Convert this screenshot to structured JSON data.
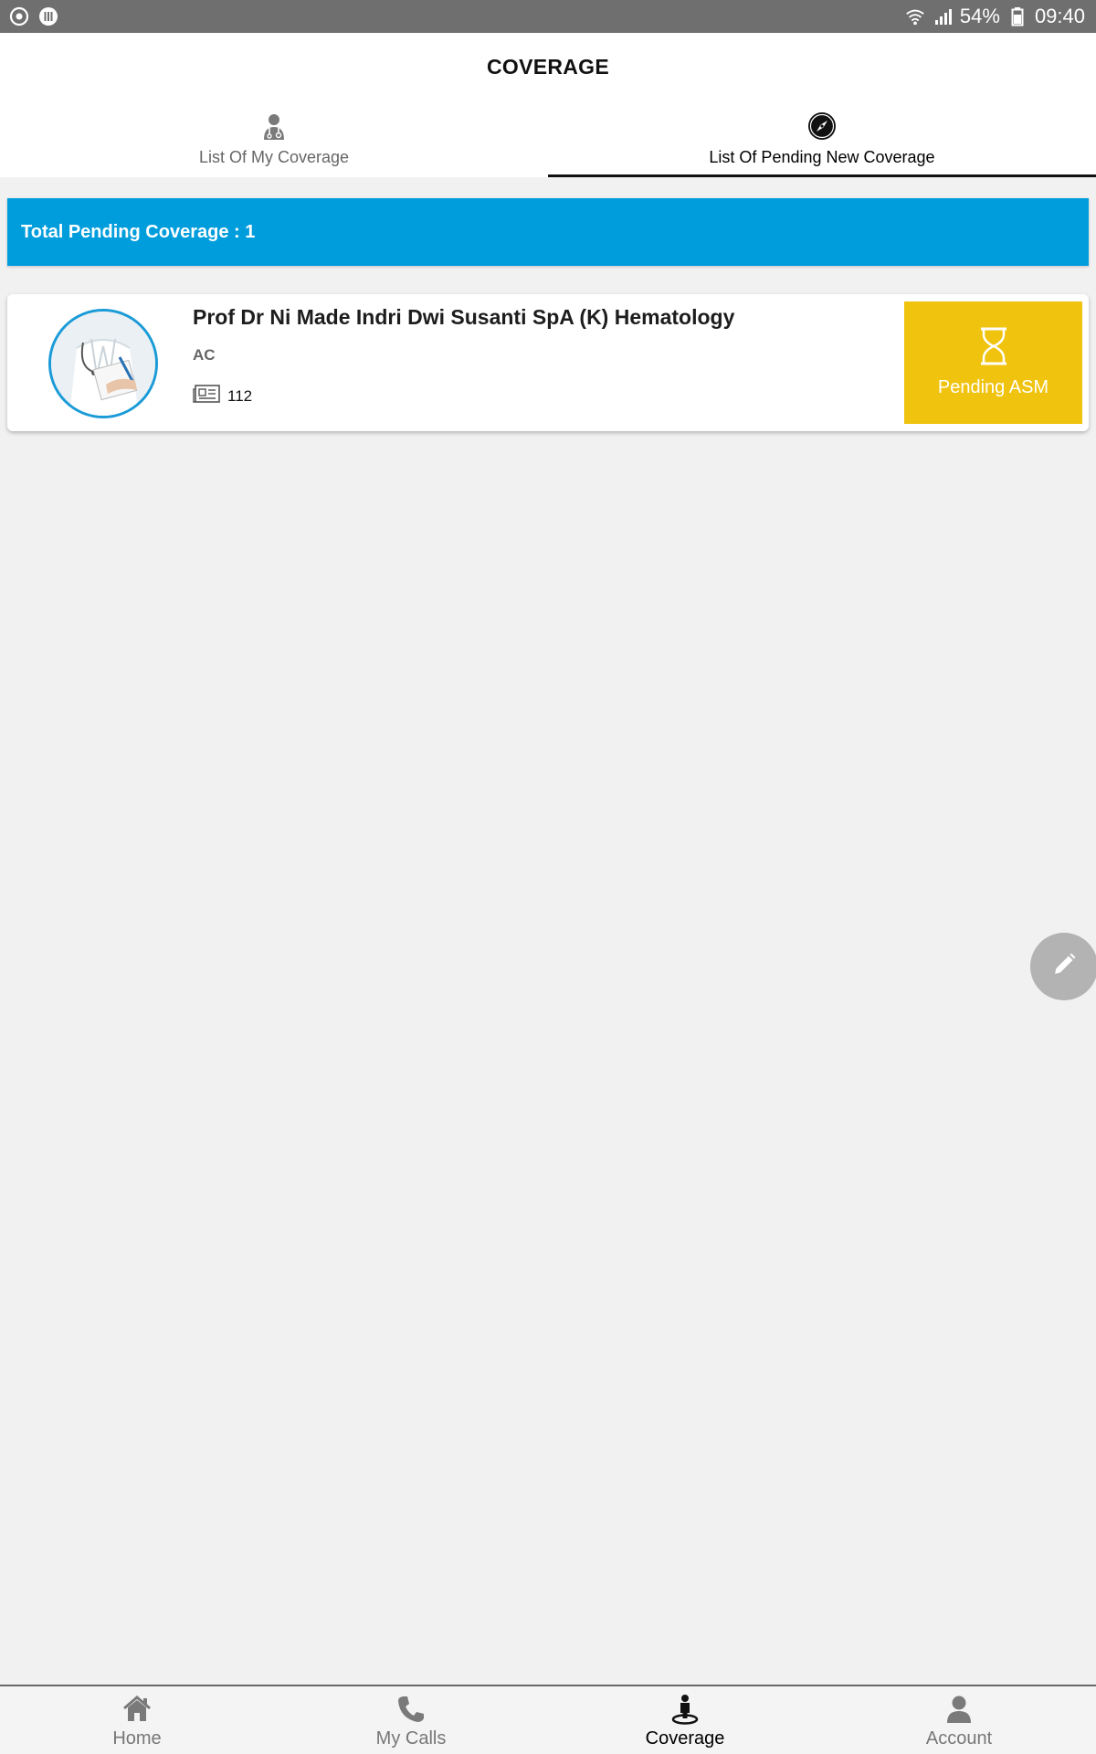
{
  "status_bar": {
    "battery": "54%",
    "time": "09:40"
  },
  "header": {
    "title": "COVERAGE",
    "tabs": [
      {
        "label": "List Of My Coverage",
        "icon": "doctor-icon",
        "active": false
      },
      {
        "label": "List Of Pending New Coverage",
        "icon": "compass-icon",
        "active": true
      }
    ]
  },
  "banner": {
    "text": "Total Pending Coverage : 1"
  },
  "items": [
    {
      "name": "Prof Dr Ni Made Indri Dwi Susanti SpA (K) Hematology",
      "class": "AC",
      "code": "112",
      "status": "Pending ASM",
      "status_color": "#f0c30f"
    }
  ],
  "bottom_nav": [
    {
      "label": "Home",
      "icon": "home-icon",
      "active": false
    },
    {
      "label": "My Calls",
      "icon": "phone-icon",
      "active": false
    },
    {
      "label": "Coverage",
      "icon": "coverage-person-icon",
      "active": true
    },
    {
      "label": "Account",
      "icon": "account-icon",
      "active": false
    }
  ],
  "colors": {
    "accent": "#009ddc",
    "pending": "#f0c30f",
    "status_bar": "#6f6f6f"
  }
}
